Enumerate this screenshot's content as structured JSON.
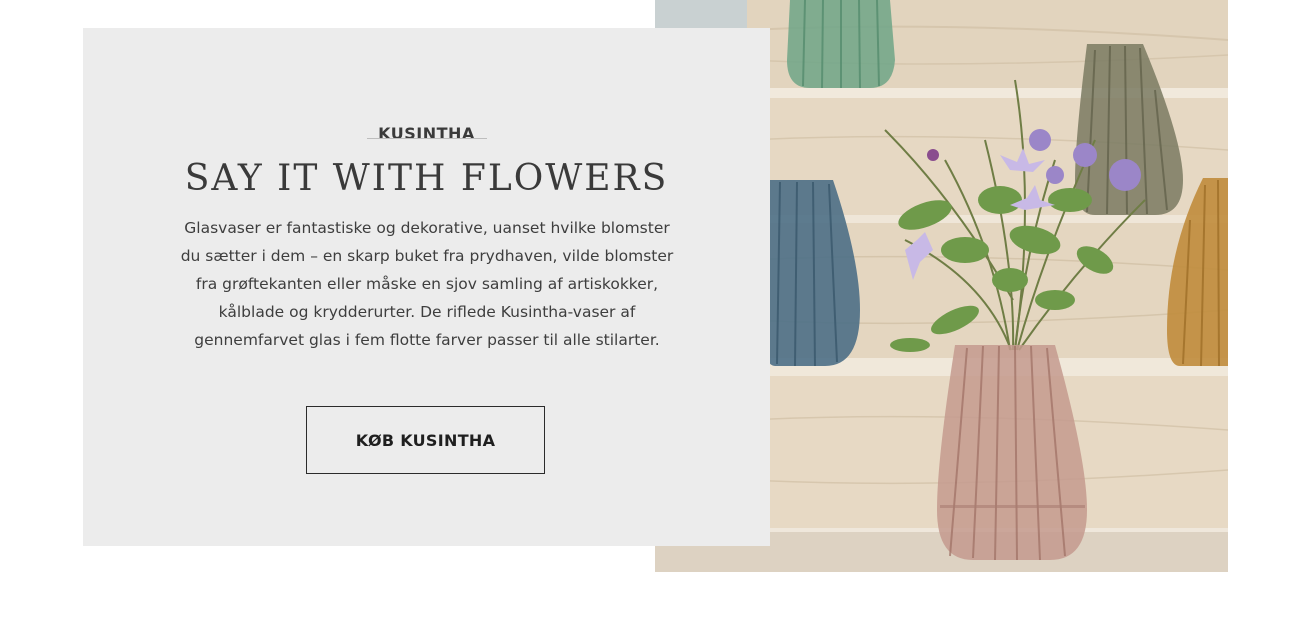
{
  "promo": {
    "eyebrow": "KUSINTHA",
    "heading": "SAY IT WITH FLOWERS",
    "body": "Glasvaser er fantastiske og dekorative, uanset hvilke blomster du sætter i dem – en skarp buket fra prydhaven, vilde blomster fra grøftekanten eller måske en sjov samling af artiskokker, kålblade og krydderurter. De riflede Kusintha-vaser af gennemfarvet glas i fem flotte farver passer til alle stilarter.",
    "cta_label": "KØB KUSINTHA"
  },
  "colors": {
    "panel_background": "#ececec",
    "text": "#3a3a3a",
    "vase_green": "#6fa487",
    "vase_smoke": "#7a7a62",
    "vase_blue": "#4d6f86",
    "vase_amber": "#c08c3c",
    "vase_rose": "#c49a8e"
  }
}
